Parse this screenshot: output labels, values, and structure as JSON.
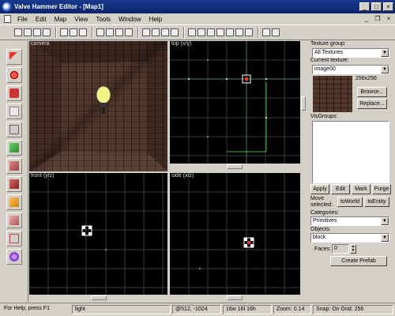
{
  "window": {
    "title": "Valve Hammer Editor - [Map1]",
    "minimize": "_",
    "maximize": "□",
    "close": "×"
  },
  "menu": [
    "File",
    "Edit",
    "Map",
    "View",
    "Tools",
    "Window",
    "Help"
  ],
  "mdi_controls": {
    "minimize": "_",
    "restore": "❐",
    "close": "×"
  },
  "viewports": {
    "camera": "camera",
    "top": "top (x/y)",
    "front": "front (y/z)",
    "side": "side (x/z)"
  },
  "panel": {
    "texture_group_label": "Texture group:",
    "texture_group_value": "All Textures",
    "current_texture_label": "Current texture:",
    "current_texture_value": "image00",
    "texture_size": "256x256",
    "browse_label": "Browse...",
    "replace_label": "Replace...",
    "visgroups_label": "VisGroups:",
    "apply_label": "Apply",
    "edit_label": "Edit",
    "mark_label": "Mark",
    "purge_label": "Purge",
    "move_selected_label": "Move selected:",
    "to_world_label": "toWorld",
    "to_entity_label": "toEntity",
    "categories_label": "Categories:",
    "categories_value": "Primitives",
    "objects_label": "Objects:",
    "objects_value": "block",
    "faces_label": "Faces:",
    "faces_value": "0",
    "create_prefab_label": "Create Prefab"
  },
  "status": {
    "help": "For Help, press F1",
    "selection": "light",
    "coords": "@512, -1024",
    "size": "16w 16l 16h",
    "zoom": "Zoom: 0.14",
    "snap": "Snap: On Grid: 256"
  }
}
